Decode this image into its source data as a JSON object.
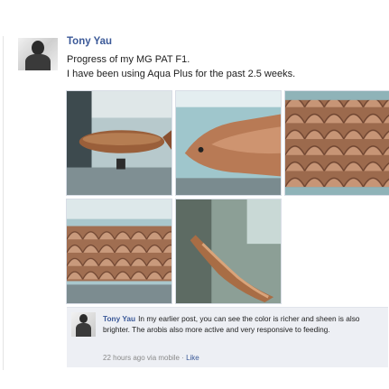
{
  "post": {
    "author": "Tony Yau",
    "text_line1": "Progress of my MG PAT F1.",
    "text_line2": "I have been using Aqua Plus for the past 2.5 weeks."
  },
  "photos": [
    {
      "label": "arowana-photo-1"
    },
    {
      "label": "arowana-photo-2"
    },
    {
      "label": "arowana-photo-3"
    },
    {
      "label": "arowana-photo-4"
    },
    {
      "label": "arowana-photo-5"
    }
  ],
  "comment": {
    "author": "Tony Yau",
    "text": "In my earlier post, you can see the color is richer and sheen is also brighter. The arobis also more active and very responsive to feeding.",
    "timestamp": "22 hours ago via mobile",
    "separator": " · ",
    "like_label": "Like"
  },
  "colors": {
    "link": "#3b5998",
    "comment_bg": "#edeff4"
  }
}
